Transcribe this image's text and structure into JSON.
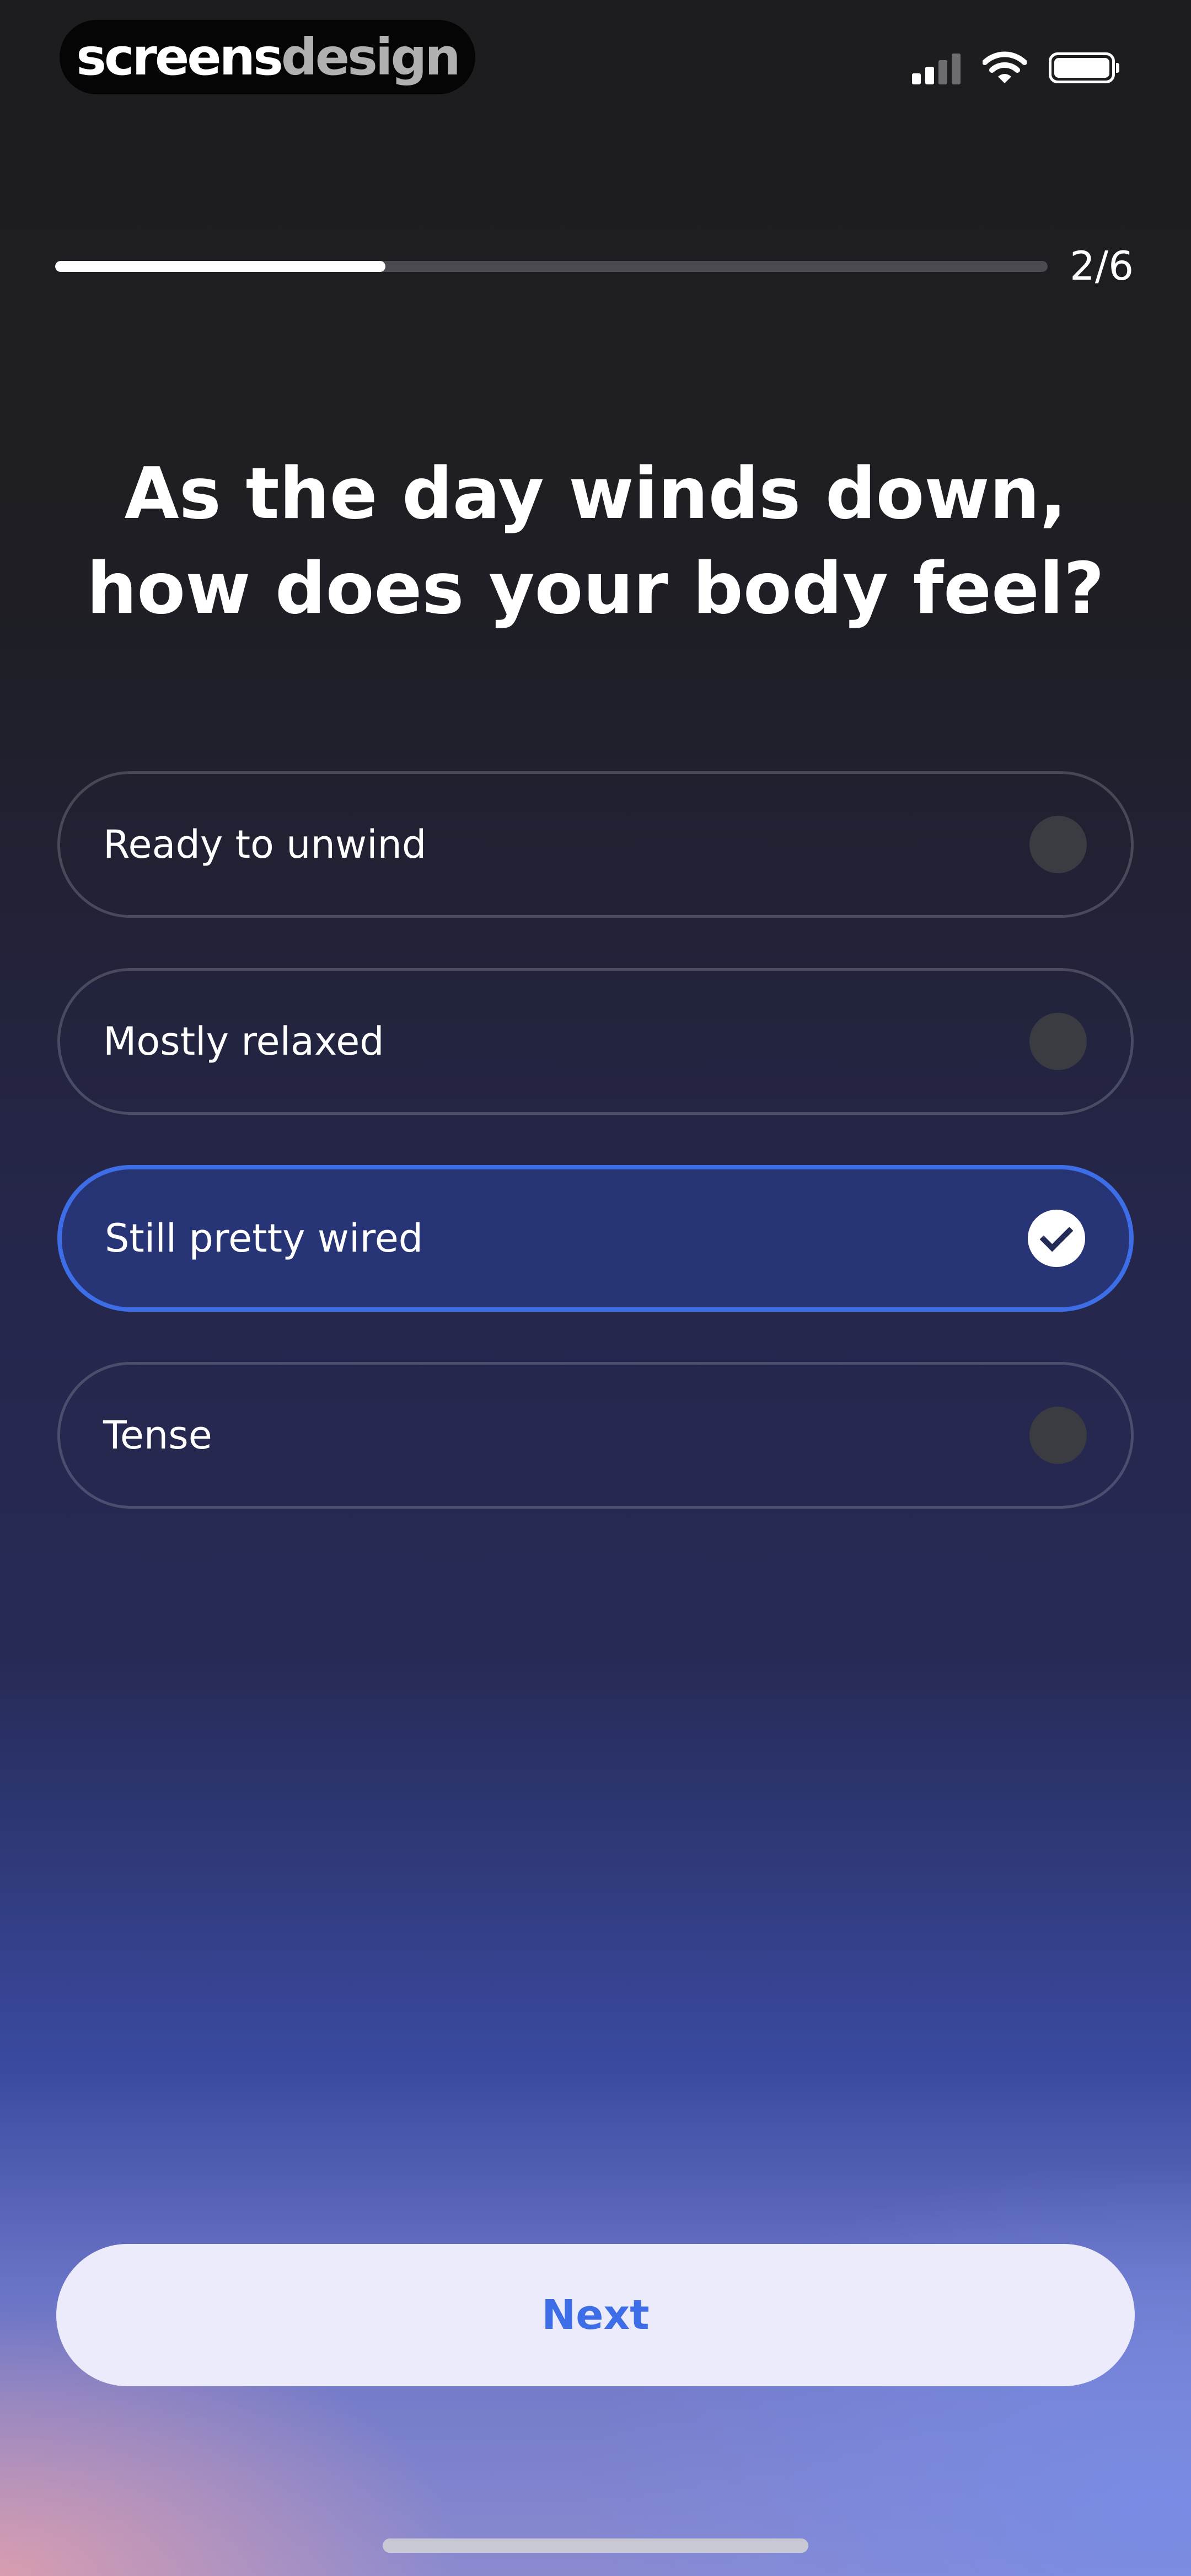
{
  "watermark": {
    "bold": "screens",
    "light": "design"
  },
  "status_bar": {
    "icons": [
      "signal-icon",
      "wifi-icon",
      "battery-icon"
    ]
  },
  "progress": {
    "label": "2/6",
    "fraction": 0.333
  },
  "question": "As the day winds down, how does your body feel?",
  "options": [
    {
      "label": "Ready to unwind",
      "selected": false
    },
    {
      "label": "Mostly relaxed",
      "selected": false
    },
    {
      "label": "Still pretty wired",
      "selected": true
    },
    {
      "label": "Tense",
      "selected": false
    }
  ],
  "next_label": "Next",
  "colors": {
    "accent": "#3d6ee8",
    "button_bg": "#ebebfb",
    "selected_bg": "#28377d"
  }
}
